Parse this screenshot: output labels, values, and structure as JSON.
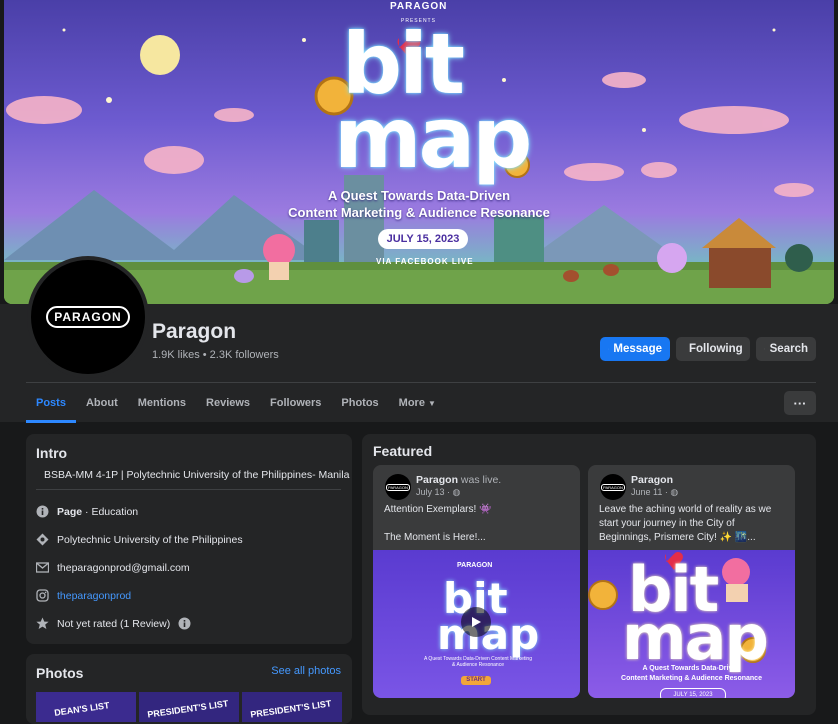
{
  "cover": {
    "brand": "PARAGON",
    "presents": "PRESENTS",
    "title_line1": "bit",
    "title_line2": "map",
    "subtitle_line1": "A Quest Towards Data-Driven",
    "subtitle_line2": "Content Marketing & Audience Resonance",
    "date": "JULY 15, 2023",
    "via": "VIA FACEBOOK LIVE"
  },
  "profile": {
    "avatar_text": "PARAGON",
    "name": "Paragon",
    "stats": "1.9K likes • 2.3K followers"
  },
  "actions": {
    "message": "Message",
    "following": "Following",
    "search": "Search"
  },
  "tabs": [
    {
      "label": "Posts"
    },
    {
      "label": "About"
    },
    {
      "label": "Mentions"
    },
    {
      "label": "Reviews"
    },
    {
      "label": "Followers"
    },
    {
      "label": "Photos"
    },
    {
      "label": "More"
    }
  ],
  "more_button": "···",
  "intro": {
    "title": "Intro",
    "bio": "BSBA-MM 4-1P | Polytechnic University of the Philippines- Manila",
    "page_label": "Page",
    "page_category": " · Education",
    "school": "Polytechnic University of the Philippines",
    "email": "theparagonprod@gmail.com",
    "instagram": "theparagonprod",
    "rating": "Not yet rated (1 Review)"
  },
  "photos": {
    "title": "Photos",
    "see_all": "See all photos",
    "thumb1_text": "DEAN'S LIST",
    "thumb2_text": "PRESIDENT'S LIST",
    "thumb3_text": "PRESIDENT'S LIST"
  },
  "featured": {
    "title": "Featured",
    "posts": [
      {
        "author": "Paragon",
        "suffix": " was live.",
        "date": "July 13 · ",
        "text1": "Attention Exemplars! 👾",
        "text2": "The Moment is Here!...",
        "img_title1": "bit",
        "img_title2": "map",
        "img_sub": "A Quest Towards Data-Driven Content Marketing & Audience Resonance",
        "img_btn": "START"
      },
      {
        "author": "Paragon",
        "suffix": "",
        "date": "June 11 · ",
        "text1": "Leave the aching world of reality as we start your journey in the City of Beginnings, Prismere City! ✨ 🌃...",
        "img_title1": "bit",
        "img_title2": "map",
        "img_sub1": "A Quest Towards Data-Driven",
        "img_sub2": "Content Marketing & Audience Resonance",
        "img_date": "JULY 15, 2023"
      }
    ]
  },
  "colors": {
    "accent": "#2d88ff",
    "brand_button": "#1877f2",
    "background": "#18191a",
    "card": "#242526"
  }
}
